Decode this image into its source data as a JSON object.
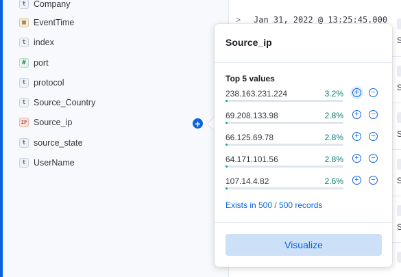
{
  "sidebar": {
    "fields": [
      {
        "name": "Company",
        "type_glyph": "t",
        "type": "string"
      },
      {
        "name": "EventTime",
        "type_glyph": "▦",
        "type": "date"
      },
      {
        "name": "index",
        "type_glyph": "t",
        "type": "string"
      },
      {
        "name": "port",
        "type_glyph": "#",
        "type": "number"
      },
      {
        "name": "protocol",
        "type_glyph": "t",
        "type": "string"
      },
      {
        "name": "Source_Country",
        "type_glyph": "t",
        "type": "string"
      },
      {
        "name": "Source_ip",
        "type_glyph": "IP",
        "type": "ip"
      },
      {
        "name": "source_state",
        "type_glyph": "t",
        "type": "string"
      },
      {
        "name": "UserName",
        "type_glyph": "t",
        "type": "string"
      }
    ],
    "add_icon": "plus-circle-icon"
  },
  "document": {
    "expand_glyph": ">",
    "timestamp": "Jan 31, 2022 @ 13:25:45.000",
    "right_letter": "S"
  },
  "popover": {
    "title": "Source_ip",
    "subtitle": "Top 5 values",
    "values": [
      {
        "value": "238.163.231.224",
        "percent_label": "3.2%",
        "percent": 3.2
      },
      {
        "value": "69.208.133.98",
        "percent_label": "2.8%",
        "percent": 2.8
      },
      {
        "value": "66.125.69.78",
        "percent_label": "2.8%",
        "percent": 2.8
      },
      {
        "value": "64.171.101.56",
        "percent_label": "2.8%",
        "percent": 2.8
      },
      {
        "value": "107.14.4.82",
        "percent_label": "2.6%",
        "percent": 2.6
      }
    ],
    "filter_in_glyph": "+",
    "filter_out_glyph": "−",
    "exists_text": "Exists in 500 / 500 records",
    "visualize_label": "Visualize"
  },
  "colors": {
    "accent": "#0b64dd",
    "percent_text": "#017d73",
    "bar_fill": "#00a69b"
  }
}
